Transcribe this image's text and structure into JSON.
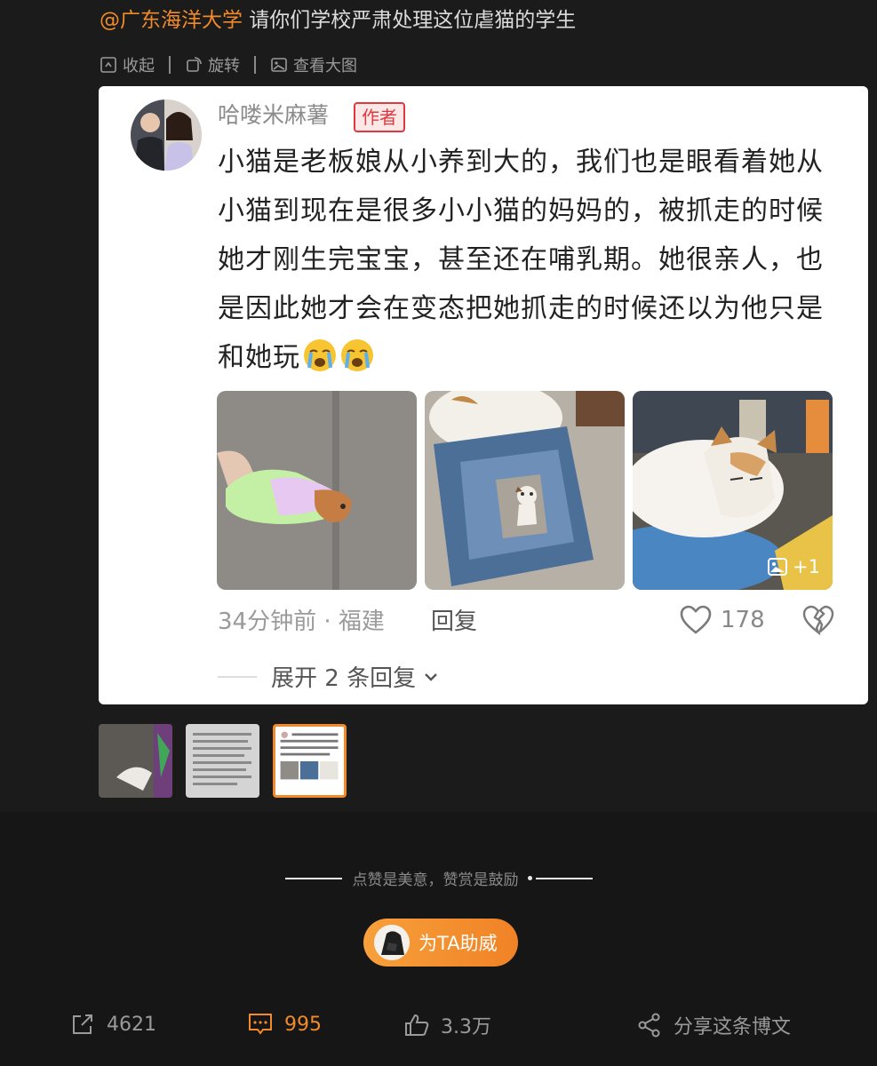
{
  "post": {
    "mention": "@广东海洋大学",
    "text": " 请你们学校严肃处理这位虐猫的学生"
  },
  "toolbar": {
    "collapse": "收起",
    "rotate": "旋转",
    "view_large": "查看大图"
  },
  "comment": {
    "username": "哈喽米麻薯",
    "badge": "作者",
    "text": "小猫是老板娘从小养到大的，我们也是眼看着她从小猫到现在是很多小小猫的妈妈的，被抓走的时候她才刚生完宝宝，甚至还在哺乳期。她很亲人，也是因此她才会在变态把她抓走的时候还以为他只是和她玩",
    "emoji": [
      "crying-face",
      "crying-face"
    ],
    "time_location": "34分钟前 · 福建",
    "reply": "回复",
    "likes": "178",
    "more_photos": "+1",
    "expand": "展开 2 条回复"
  },
  "praise": {
    "text": "点赞是美意，赞赏是鼓励"
  },
  "cheer_button": {
    "label": "为TA助威"
  },
  "actions": {
    "share_count": "4621",
    "comment_count": "995",
    "like_count": "3.3万",
    "share_post": "分享这条博文"
  },
  "colors": {
    "accent": "#f08a2a",
    "badge_red": "#e0383e",
    "background": "#1b1b1b"
  }
}
